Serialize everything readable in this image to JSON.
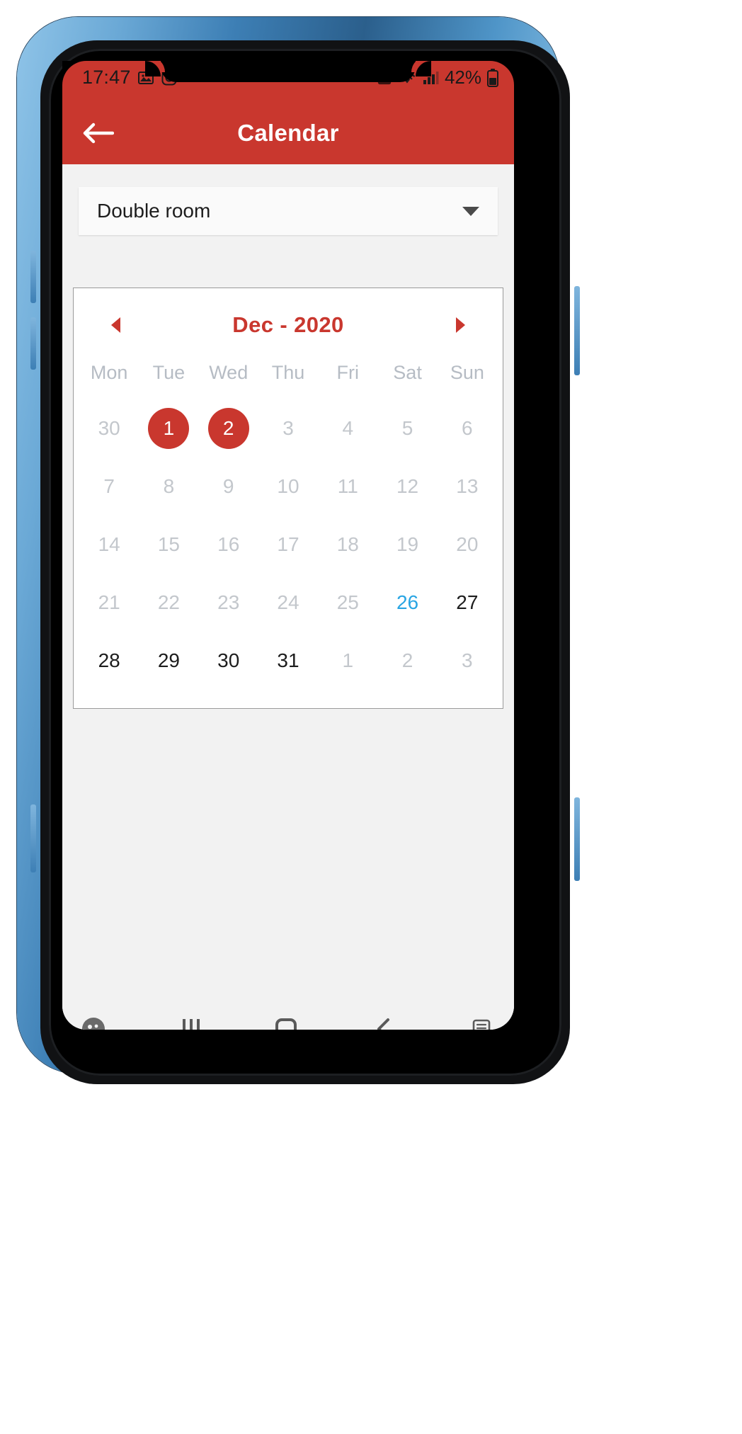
{
  "status_bar": {
    "time": "17:47",
    "left_icons": [
      "image-icon",
      "instagram-icon"
    ],
    "right_icons": [
      "recycle-icon",
      "wifi-icon",
      "signal-icon"
    ],
    "battery_percent": "42%",
    "battery_icon": "battery-icon"
  },
  "app_bar": {
    "back_icon": "back-arrow-icon",
    "title": "Calendar",
    "background_color": "#c9372e"
  },
  "room_selector": {
    "value": "Double room",
    "caret_icon": "chevron-down-icon"
  },
  "calendar": {
    "prev_icon": "triangle-left-icon",
    "next_icon": "triangle-right-icon",
    "title": "Dec - 2020",
    "title_color": "#c9372e",
    "weekdays": [
      "Mon",
      "Tue",
      "Wed",
      "Thu",
      "Fri",
      "Sat",
      "Sun"
    ],
    "selected_color": "#c9372e",
    "today_color": "#29a5e3",
    "days": [
      {
        "label": "30",
        "state": "muted"
      },
      {
        "label": "1",
        "state": "selected"
      },
      {
        "label": "2",
        "state": "selected"
      },
      {
        "label": "3",
        "state": "muted"
      },
      {
        "label": "4",
        "state": "muted"
      },
      {
        "label": "5",
        "state": "muted"
      },
      {
        "label": "6",
        "state": "muted"
      },
      {
        "label": "7",
        "state": "muted"
      },
      {
        "label": "8",
        "state": "muted"
      },
      {
        "label": "9",
        "state": "muted"
      },
      {
        "label": "10",
        "state": "muted"
      },
      {
        "label": "11",
        "state": "muted"
      },
      {
        "label": "12",
        "state": "muted"
      },
      {
        "label": "13",
        "state": "muted"
      },
      {
        "label": "14",
        "state": "muted"
      },
      {
        "label": "15",
        "state": "muted"
      },
      {
        "label": "16",
        "state": "muted"
      },
      {
        "label": "17",
        "state": "muted"
      },
      {
        "label": "18",
        "state": "muted"
      },
      {
        "label": "19",
        "state": "muted"
      },
      {
        "label": "20",
        "state": "muted"
      },
      {
        "label": "21",
        "state": "muted"
      },
      {
        "label": "22",
        "state": "muted"
      },
      {
        "label": "23",
        "state": "muted"
      },
      {
        "label": "24",
        "state": "muted"
      },
      {
        "label": "25",
        "state": "muted"
      },
      {
        "label": "26",
        "state": "today"
      },
      {
        "label": "27",
        "state": "normal"
      },
      {
        "label": "28",
        "state": "normal"
      },
      {
        "label": "29",
        "state": "normal"
      },
      {
        "label": "30",
        "state": "normal"
      },
      {
        "label": "31",
        "state": "normal"
      },
      {
        "label": "1",
        "state": "muted"
      },
      {
        "label": "2",
        "state": "muted"
      },
      {
        "label": "3",
        "state": "muted"
      }
    ]
  },
  "nav_bar": {
    "items": [
      "accessibility-icon",
      "recents-icon",
      "home-icon",
      "back-icon",
      "keyboard-icon"
    ]
  }
}
